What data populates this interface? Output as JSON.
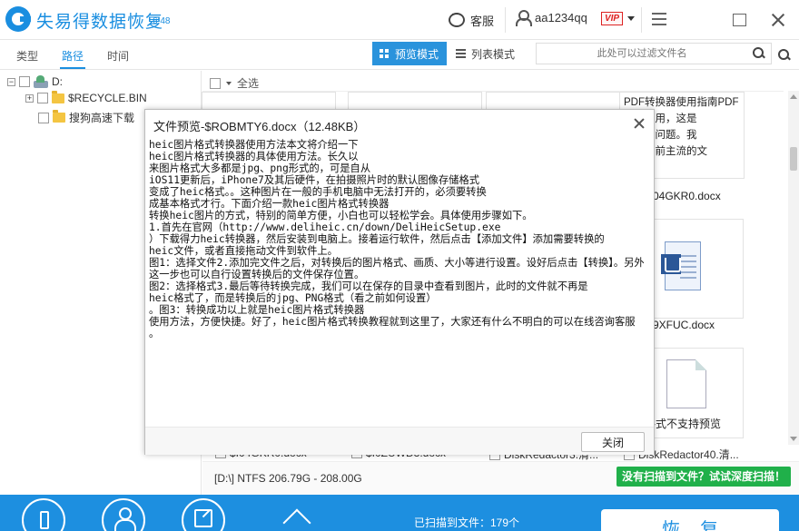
{
  "app": {
    "title": "失易得数据恢复",
    "version": "6.48"
  },
  "titlebar": {
    "service_label": "客服",
    "username": "aa1234qq",
    "vip_badge": "VIP"
  },
  "toolbar": {
    "tabs": [
      "类型",
      "路径",
      "时间"
    ],
    "active_tab": "路径",
    "preview_mode_label": "预览模式",
    "list_mode_label": "列表模式",
    "filter_placeholder": "此处可以过滤文件名"
  },
  "tree": {
    "root_label": "D:",
    "items": [
      "$RECYCLE.BIN",
      "搜狗高速下载"
    ]
  },
  "content": {
    "select_all_label": "全选",
    "card_text_lines": [
      "PDF转换器使用指南PDF",
      "如何使用，这是",
      "关心的问题。我",
      "",
      "式是目前主流的文"
    ],
    "cards": [
      {
        "name": "04GKR0.docx"
      },
      {
        "name": "9XFUC.docx"
      },
      {
        "name": "格式不支持预览"
      }
    ],
    "bottom_files": [
      "$I04GKR0.docx",
      "$I0ZUWD3.docx",
      "DiskRedactor3.清...",
      "DiskRedactor40.清..."
    ],
    "disk_info": "[D:\\] NTFS 206.79G - 208.00G",
    "deep_scan_label": "没有扫描到文件？试试深度扫描！"
  },
  "footer": {
    "scan_status": "已扫描到文件：179个",
    "recover_label": "恢复"
  },
  "modal": {
    "title": "文件预览-$ROBMTY6.docx（12.48KB）",
    "body_text": "heic图片格式转换器使用方法本文将介绍一下\nheic图片格式转换器的具体使用方法。长久以\n来图片格式大多都是jpg、png形式的，可是自从\niOS11更新后，iPhone7及其后硬件，在拍摄照片时的默认图像存储格式\n变成了heic格式。。这种图片在一般的手机电脑中无法打开的，必须要转换\n成基本格式才行。下面介绍一款heic图片格式转换器\n转换heic图片的方式，特别的简单方便，小白也可以轻松学会。具体使用步骤如下。\n1.首先在官网（http://www.deliheic.cn/down/DeliHeicSetup.exe\n）下载得力heic转换器，然后安装到电脑上。接着运行软件，然后点击【添加文件】添加需要转换的\nheic文件，或者直接拖动文件到软件上。\n图1：选择文件2.添加完文件之后，对转换后的图片格式、画质、大小等进行设置。设好后点击【转换】。另外这一步也可以自行设置转换后的文件保存位置。\n图2：选择格式3.最后等待转换完成，我们可以在保存的目录中查看到图片，此时的文件就不再是\nheic格式了，而是转换后的jpg、PNG格式（看之前如何设置）\n。图3：转换成功以上就是heic图片格式转换器\n使用方法，方便快捷。好了，heic图片格式转换教程就到这里了，大家还有什么不明白的可以在线咨询客服\n。",
    "close_button": "关闭"
  }
}
